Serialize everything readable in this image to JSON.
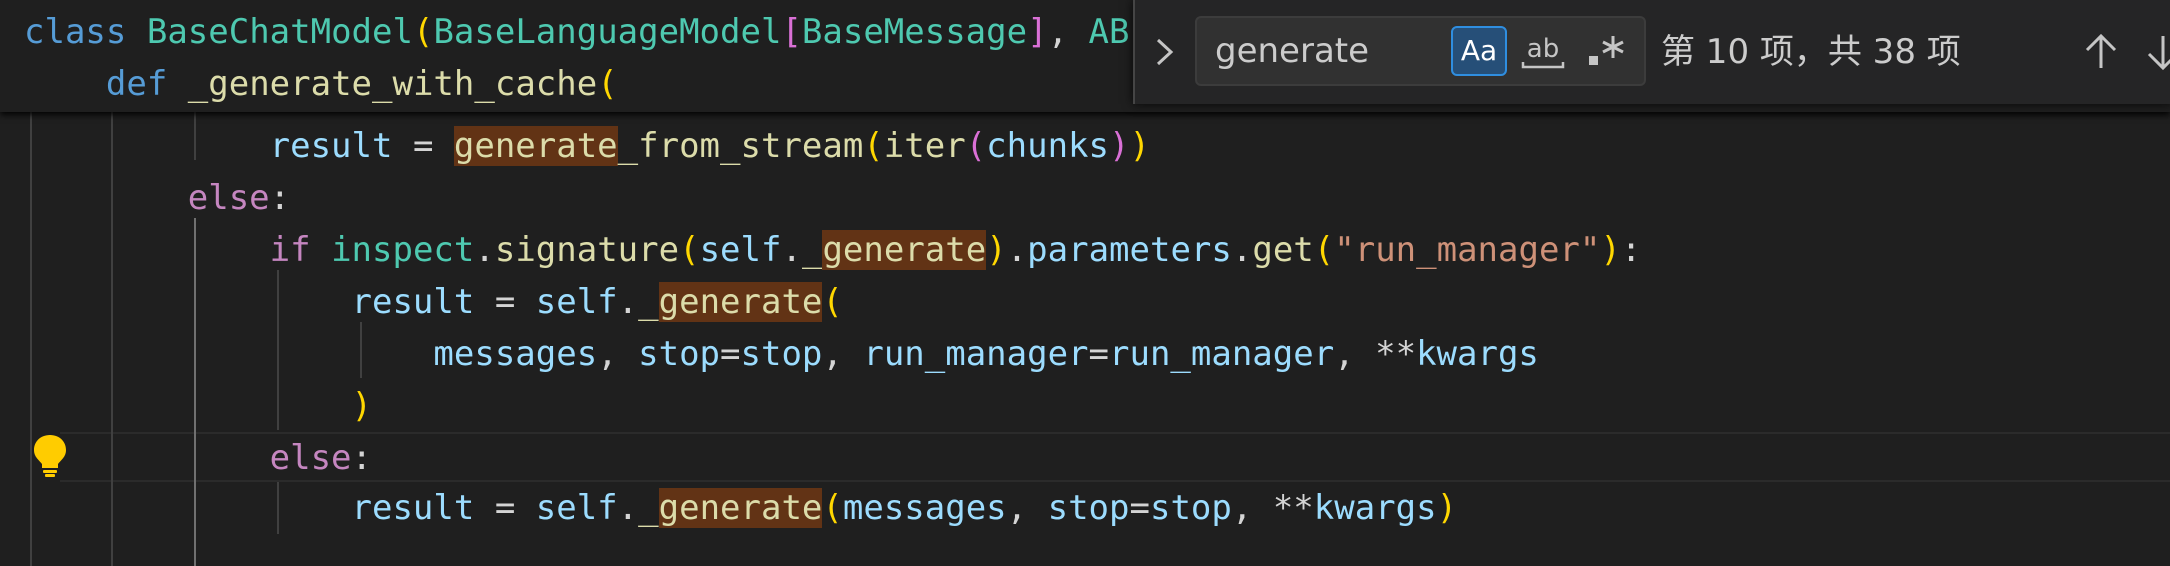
{
  "sticky": {
    "line1": {
      "class_kw": "class",
      "class_name": "BaseChatModel",
      "paren_open": "(",
      "base": "BaseLanguageModel",
      "bracket_open": "[",
      "msg": "BaseMessage",
      "bracket_close": "]",
      "comma": ",",
      "trunc": "AB"
    },
    "line2": {
      "def_kw": "def",
      "fn_name": "_generate_with_cache",
      "paren_open": "("
    }
  },
  "code": {
    "l1": {
      "v": "result",
      "eq": " = ",
      "match": "generate",
      "rest": "_from_stream",
      "p1": "(",
      "f": "iter",
      "p2": "(",
      "a": "chunks",
      "p3": ")",
      "p4": ")"
    },
    "l2": {
      "kw": "else",
      "colon": ":"
    },
    "l3": {
      "kw": "if",
      "mod": "inspect",
      "dot1": ".",
      "f": "signature",
      "p1": "(",
      "self": "self",
      "dot2": ".",
      "under": "_",
      "match": "generate",
      "p2": ")",
      "dot3": ".",
      "attr": "parameters",
      "dot4": ".",
      "get": "get",
      "p3": "(",
      "s": "\"run_manager\"",
      "p4": ")",
      "colon": ":"
    },
    "l4": {
      "v": "result",
      "eq": " = ",
      "self": "self",
      "dot": ".",
      "under": "_",
      "match": "generate",
      "p": "("
    },
    "l5": {
      "a1": "messages",
      "c1": ", ",
      "a2": "stop",
      "eq1": "=",
      "a3": "stop",
      "c2": ", ",
      "a4": "run_manager",
      "eq2": "=",
      "a5": "run_manager",
      "c3": ", ",
      "star": "**",
      "a6": "kwargs"
    },
    "l6": {
      "p": ")"
    },
    "l7": {
      "kw": "else",
      "colon": ":"
    },
    "l8": {
      "v": "result",
      "eq": " = ",
      "self": "self",
      "dot": ".",
      "under": "_",
      "match": "generate",
      "p1": "(",
      "a1": "messages",
      "c1": ", ",
      "a2": "stop",
      "eq1": "=",
      "a3": "stop",
      "c2": ", ",
      "star": "**",
      "a4": "kwargs",
      "p2": ")"
    }
  },
  "find": {
    "query": "generate",
    "match_case_label": "Aa",
    "match_case_on": true,
    "whole_word_label": "ab",
    "regex_label": ".*",
    "result_text": "第 10 项，共 38 项",
    "icons": [
      "chevron-right-icon",
      "arrow-up-icon",
      "arrow-down-icon",
      "lightbulb-icon"
    ]
  },
  "colors": {
    "background": "#1f1f1f",
    "match_highlight": "#623315",
    "toggle_active": "#264f78"
  }
}
